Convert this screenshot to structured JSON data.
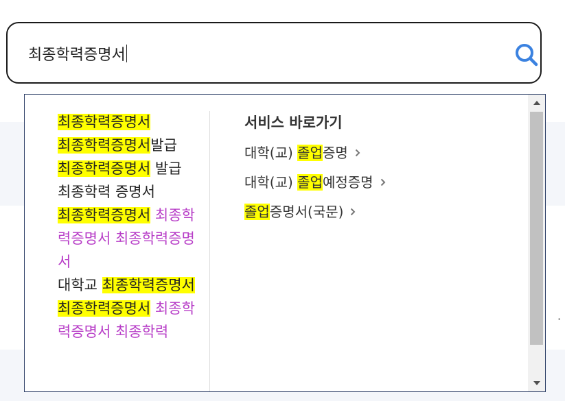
{
  "search": {
    "value": "최종학력증명서"
  },
  "suggestions": [
    [
      {
        "t": "최종학력증명서",
        "s": "hl"
      }
    ],
    [
      {
        "t": "최종학력증명서",
        "s": "hl"
      },
      {
        "t": "발급",
        "s": ""
      }
    ],
    [
      {
        "t": "최종학력증명서",
        "s": "hl"
      },
      {
        "t": " 발급",
        "s": ""
      }
    ],
    [
      {
        "t": "최종학력 증명서",
        "s": ""
      }
    ],
    [
      {
        "t": "최종학력증명서",
        "s": "hl"
      },
      {
        "t": " 최종학력증명서 최종학력증명서",
        "s": "purple"
      }
    ],
    [
      {
        "t": "대학교 ",
        "s": ""
      },
      {
        "t": "최종학력증명서",
        "s": "hl"
      }
    ],
    [
      {
        "t": "최종학력증명서",
        "s": "hl"
      },
      {
        "t": " 최종학력증명서 최종학력",
        "s": "purple"
      }
    ]
  ],
  "shortcuts": {
    "title": "서비스 바로가기",
    "items": [
      [
        {
          "t": "대학(교) ",
          "s": ""
        },
        {
          "t": "졸업",
          "s": "hl"
        },
        {
          "t": "증명",
          "s": ""
        }
      ],
      [
        {
          "t": "대학(교) ",
          "s": ""
        },
        {
          "t": "졸업",
          "s": "hl"
        },
        {
          "t": "예정증명",
          "s": ""
        }
      ],
      [
        {
          "t": "졸업",
          "s": "hl"
        },
        {
          "t": "증명서(국문)",
          "s": ""
        }
      ]
    ]
  },
  "colors": {
    "highlight": "#ffff00",
    "purple_text": "#b73cc7",
    "search_icon": "#3b82e0"
  },
  "icons": {
    "search": "magnifier-icon",
    "chevron": "chevron-right-icon",
    "scroll_up": "triangle-up-icon",
    "scroll_down": "triangle-down-icon"
  }
}
